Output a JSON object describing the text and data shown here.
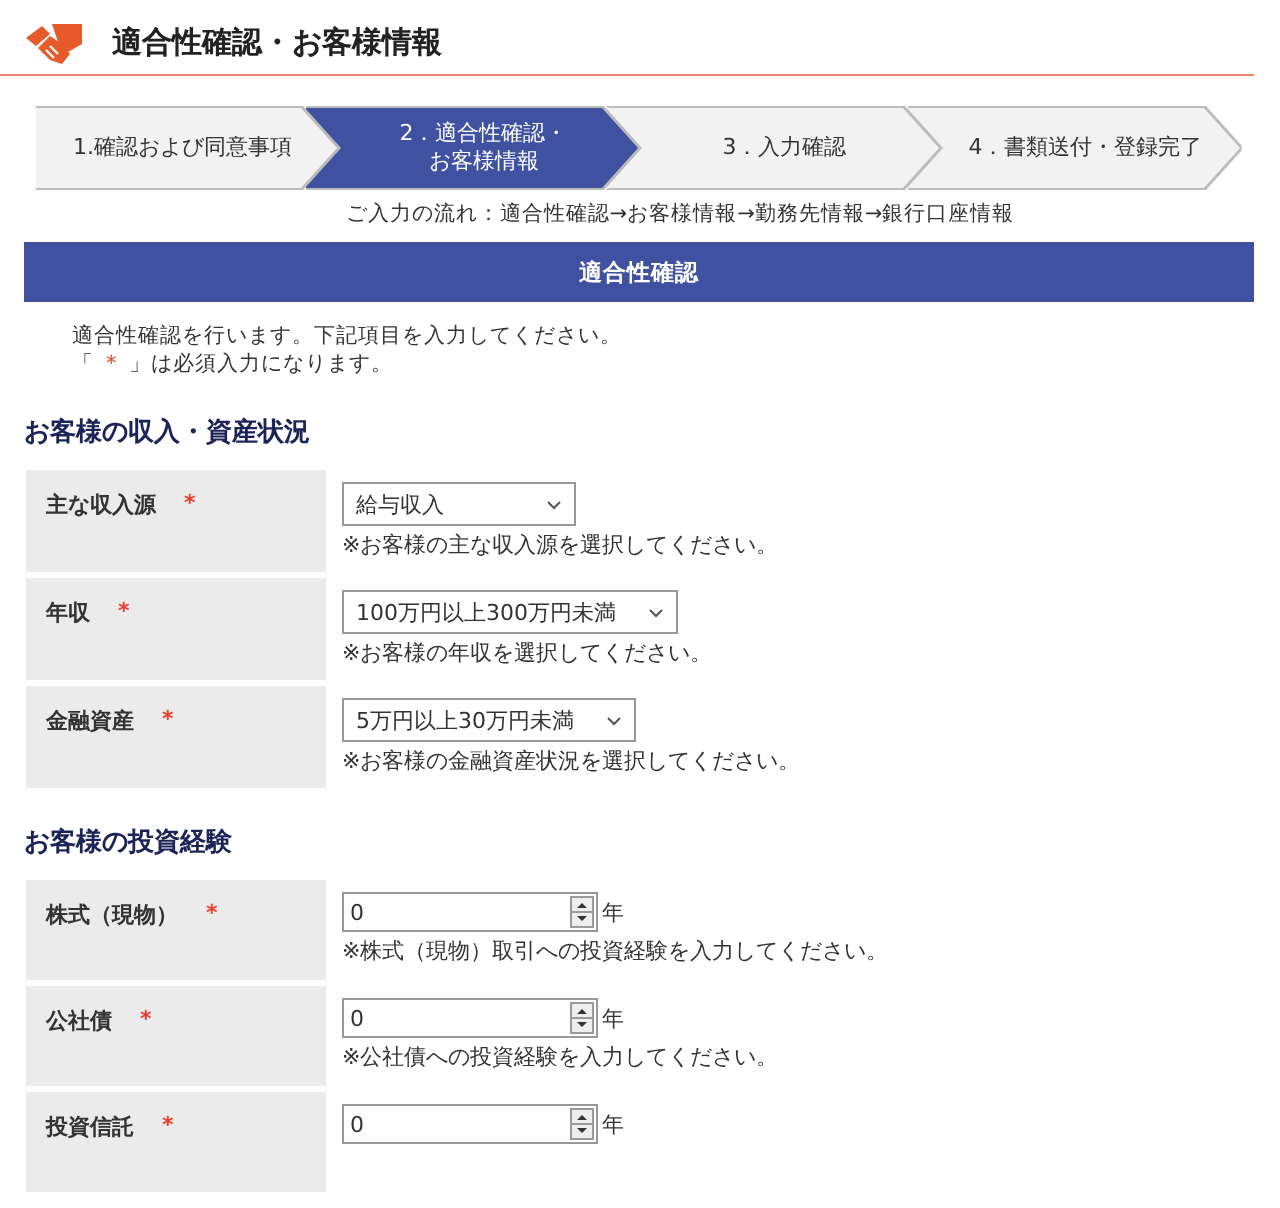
{
  "header": {
    "title": "適合性確認・お客様情報"
  },
  "steps": [
    {
      "lines": [
        "1.確認および同意事項"
      ],
      "selected": false
    },
    {
      "lines": [
        "2．適合性確認・",
        "お客様情報"
      ],
      "selected": true
    },
    {
      "lines": [
        "3．入力確認"
      ],
      "selected": false
    },
    {
      "lines": [
        "4．書類送付・登録完了"
      ],
      "selected": false
    }
  ],
  "flow_note": "ご入力の流れ：適合性確認→お客様情報→勤務先情報→銀行口座情報",
  "banner": "適合性確認",
  "intro": "適合性確認を行います。下記項目を入力してください。",
  "required_note": {
    "open": "「",
    "mark": "*",
    "close": "」は必須入力になります。"
  },
  "sections": [
    {
      "heading": "お客様の収入・資産状況",
      "fields": [
        {
          "kind": "select",
          "label": "主な収入源",
          "mark": "*",
          "value": "給与収入",
          "hint": "※お客様の主な収入源を選択してください。"
        },
        {
          "kind": "select",
          "label": "年収",
          "mark": "*",
          "value": "100万円以上300万円未満",
          "hint": "※お客様の年収を選択してください。"
        },
        {
          "kind": "select",
          "label": "金融資産",
          "mark": "*",
          "value": "5万円以上30万円未満",
          "hint": "※お客様の金融資産状況を選択してください。"
        }
      ]
    },
    {
      "heading": "お客様の投資経験",
      "fields": [
        {
          "kind": "number",
          "label": "株式（現物）",
          "mark": "*",
          "value": "0",
          "unit": "年",
          "hint": "※株式（現物）取引への投資経験を入力してください。"
        },
        {
          "kind": "number",
          "label": "公社債",
          "mark": "*",
          "value": "0",
          "unit": "年",
          "hint": "※公社債への投資経験を入力してください。"
        },
        {
          "kind": "number",
          "label": "投資信託",
          "mark": "*",
          "value": "0",
          "unit": "年"
        }
      ]
    }
  ]
}
